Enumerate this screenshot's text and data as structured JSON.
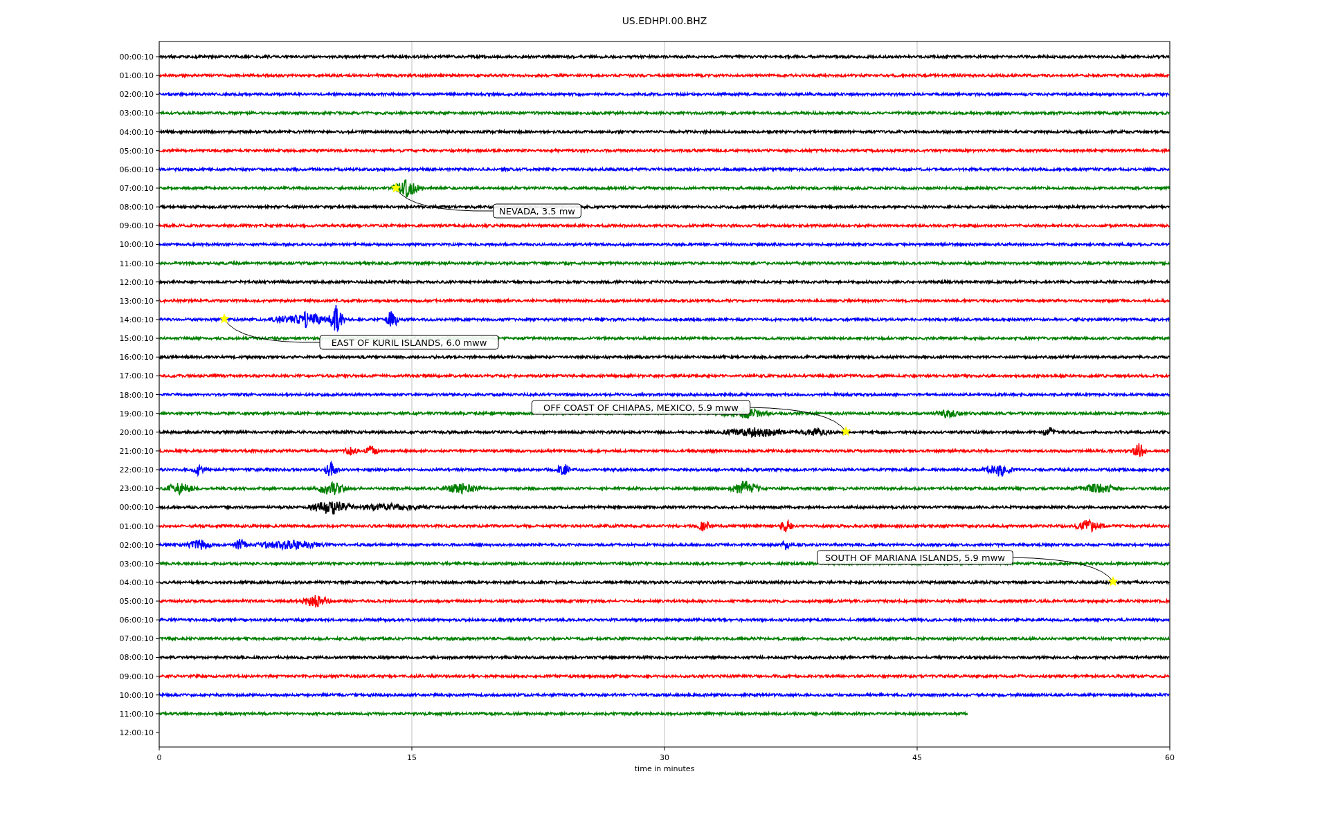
{
  "plot": {
    "title": "US.EDHPI.00.BHZ",
    "xlabel": "time in minutes",
    "xticks": [
      "0",
      "15",
      "30",
      "45",
      "60"
    ],
    "rows": [
      {
        "label": "00:00:10",
        "kind": "full",
        "color": "#000000"
      },
      {
        "label": "01:00:10",
        "kind": "full",
        "color": "#ff0000"
      },
      {
        "label": "02:00:10",
        "kind": "full",
        "color": "#0000ff"
      },
      {
        "label": "03:00:10",
        "kind": "full",
        "color": "#008000"
      },
      {
        "label": "04:00:10",
        "kind": "full",
        "color": "#000000"
      },
      {
        "label": "05:00:10",
        "kind": "full",
        "color": "#ff0000"
      },
      {
        "label": "06:00:10",
        "kind": "full",
        "color": "#0000ff"
      },
      {
        "label": "07:00:10",
        "kind": "full",
        "color": "#008000"
      },
      {
        "label": "08:00:10",
        "kind": "full",
        "color": "#000000"
      },
      {
        "label": "09:00:10",
        "kind": "full",
        "color": "#ff0000"
      },
      {
        "label": "10:00:10",
        "kind": "full",
        "color": "#0000ff"
      },
      {
        "label": "11:00:10",
        "kind": "full",
        "color": "#008000"
      },
      {
        "label": "12:00:10",
        "kind": "full",
        "color": "#000000"
      },
      {
        "label": "13:00:10",
        "kind": "full",
        "color": "#ff0000"
      },
      {
        "label": "14:00:10",
        "kind": "full",
        "color": "#0000ff"
      },
      {
        "label": "15:00:10",
        "kind": "full",
        "color": "#008000"
      },
      {
        "label": "16:00:10",
        "kind": "full",
        "color": "#000000"
      },
      {
        "label": "17:00:10",
        "kind": "full",
        "color": "#ff0000"
      },
      {
        "label": "18:00:10",
        "kind": "full",
        "color": "#0000ff"
      },
      {
        "label": "19:00:10",
        "kind": "full",
        "color": "#008000"
      },
      {
        "label": "20:00:10",
        "kind": "full",
        "color": "#000000"
      },
      {
        "label": "21:00:10",
        "kind": "full",
        "color": "#ff0000"
      },
      {
        "label": "22:00:10",
        "kind": "full",
        "color": "#0000ff"
      },
      {
        "label": "23:00:10",
        "kind": "full",
        "color": "#008000"
      },
      {
        "label": "00:00:10",
        "kind": "full",
        "color": "#000000"
      },
      {
        "label": "01:00:10",
        "kind": "full",
        "color": "#ff0000"
      },
      {
        "label": "02:00:10",
        "kind": "full",
        "color": "#0000ff"
      },
      {
        "label": "03:00:10",
        "kind": "full",
        "color": "#008000"
      },
      {
        "label": "04:00:10",
        "kind": "full",
        "color": "#000000"
      },
      {
        "label": "05:00:10",
        "kind": "full",
        "color": "#ff0000"
      },
      {
        "label": "06:00:10",
        "kind": "full",
        "color": "#0000ff"
      },
      {
        "label": "07:00:10",
        "kind": "full",
        "color": "#008000"
      },
      {
        "label": "08:00:10",
        "kind": "full",
        "color": "#000000"
      },
      {
        "label": "09:00:10",
        "kind": "full",
        "color": "#ff0000"
      },
      {
        "label": "10:00:10",
        "kind": "full",
        "color": "#0000ff"
      },
      {
        "label": "11:00:10",
        "kind": "partial",
        "color": "#008000"
      },
      {
        "label": "12:00:10",
        "kind": "empty"
      }
    ],
    "events": [
      {
        "label": "NEVADA, 3.5 mw"
      },
      {
        "label": "EAST OF KURIL ISLANDS, 6.0 mww"
      },
      {
        "label": "OFF COAST OF CHIAPAS, MEXICO, 5.9 mww"
      },
      {
        "label": "SOUTH OF MARIANA ISLANDS, 5.9 mww"
      }
    ]
  }
}
